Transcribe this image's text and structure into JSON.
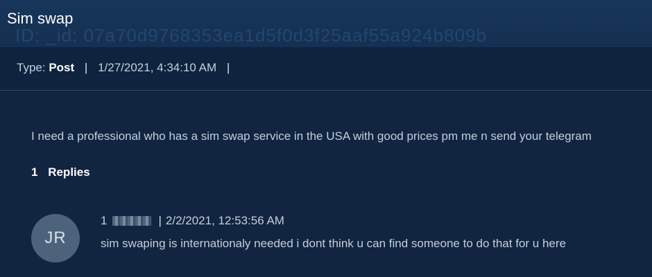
{
  "post": {
    "title": "Sim swap",
    "id_text": "ID: _id: 07a70d9768353ea1d5f0d3f25aaf55a924b809b",
    "type_label": "Type:",
    "type_value": "Post",
    "timestamp": "1/27/2021, 4:34:10 AM",
    "body": "I need a professional who has a sim swap service in the USA with good prices pm me n send your telegram"
  },
  "replies": {
    "count": "1",
    "label": "Replies",
    "items": [
      {
        "avatar_initials": "JR",
        "index": "1",
        "timestamp": "2/2/2021, 12:53:56 AM",
        "body": "sim swaping is internationaly needed i dont think u can find someone to do that for u here"
      }
    ]
  },
  "colors": {
    "background": "#112440",
    "title_bar": "#17365a",
    "meta_row": "#0f233f",
    "avatar": "#4d637c",
    "text": "#c4cfdc",
    "heading": "#ffffff"
  }
}
